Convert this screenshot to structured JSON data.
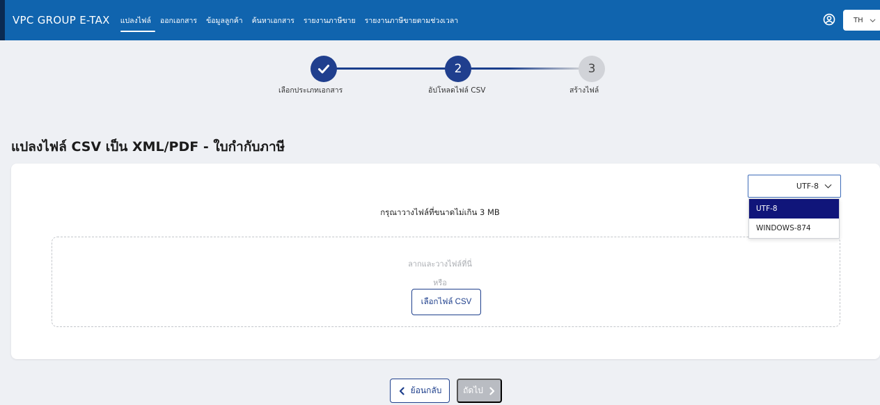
{
  "nav": {
    "brand": "VPC GROUP E-TAX",
    "items": [
      {
        "label": "แปลงไฟล์",
        "active": true
      },
      {
        "label": "ออกเอกสาร"
      },
      {
        "label": "ข้อมูลลูกค้า"
      },
      {
        "label": "ค้นหาเอกสาร"
      },
      {
        "label": "รายงานภาษีขาย"
      },
      {
        "label": "รายงานภาษีขายตามช่วงเวลา"
      }
    ],
    "user_icon": "user-circle-icon",
    "language": "TH"
  },
  "stepper": {
    "steps": [
      {
        "number": "✓",
        "label": "เลือกประเภทเอกสาร",
        "state": "done"
      },
      {
        "number": "2",
        "label": "อัปโหลดไฟล์ CSV",
        "state": "active"
      },
      {
        "number": "3",
        "label": "สร้างไฟล์",
        "state": "pending"
      }
    ]
  },
  "page": {
    "title": "แปลงไฟล์ CSV เป็น XML/PDF - ใบกำกับภาษี"
  },
  "upload": {
    "encoding_selected": "UTF-8",
    "encoding_options": [
      "UTF-8",
      "WINDOWS-874"
    ],
    "hint": "กรุณาวางไฟล์ที่ขนาดไม่เกิน 3 MB",
    "drag_text": "ลากและวางไฟล์ที่นี่",
    "or_text": "หรือ",
    "choose_button": "เลือกไฟล์ CSV"
  },
  "footer": {
    "back_label": "ย้อนกลับ",
    "next_label": "ถัดไป"
  },
  "colors": {
    "nav_bg": "#1064ae",
    "primary": "#203f8e",
    "selected_option": "#10157a",
    "disabled": "#b9bcc2"
  }
}
